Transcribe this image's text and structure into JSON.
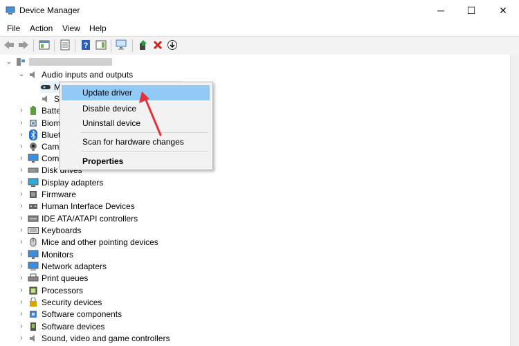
{
  "window": {
    "title": "Device Manager",
    "minimize": "─",
    "maximize": "☐",
    "close": "✕"
  },
  "menu": [
    "File",
    "Action",
    "View",
    "Help"
  ],
  "tree": {
    "audio": {
      "label": "Audio inputs and outputs",
      "children": [
        "M",
        "S"
      ]
    },
    "items": [
      "Batte",
      "Biom",
      "Bluet",
      "Came",
      "Com",
      "Disk drives",
      "Display adapters",
      "Firmware",
      "Human Interface Devices",
      "IDE ATA/ATAPI controllers",
      "Keyboards",
      "Mice and other pointing devices",
      "Monitors",
      "Network adapters",
      "Print queues",
      "Processors",
      "Security devices",
      "Software components",
      "Software devices",
      "Sound, video and game controllers"
    ]
  },
  "context_menu": {
    "update": "Update driver",
    "disable": "Disable device",
    "uninstall": "Uninstall device",
    "scan": "Scan for hardware changes",
    "properties": "Properties"
  },
  "colors": {
    "highlight": "#91c9f7",
    "annotation_arrow": "#e5323a"
  }
}
